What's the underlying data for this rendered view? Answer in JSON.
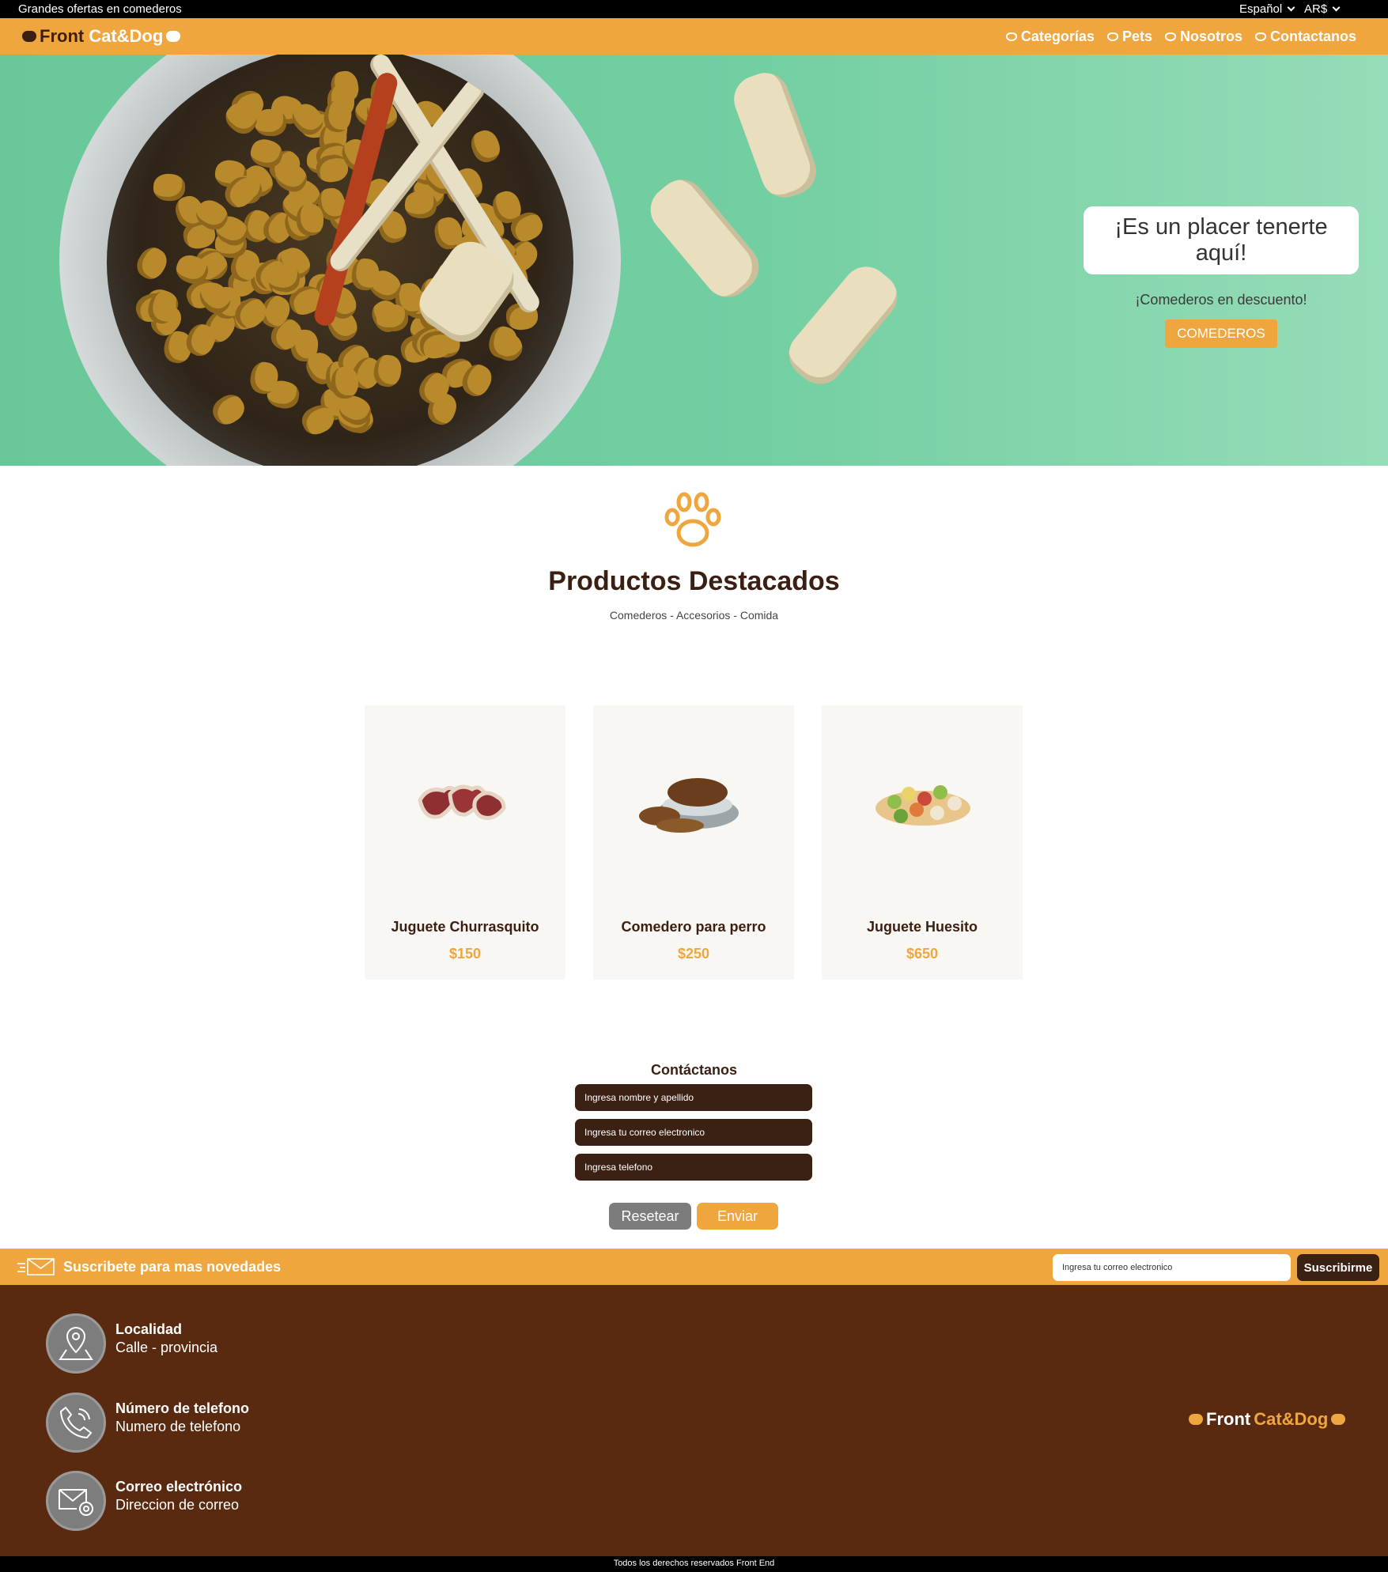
{
  "topbar": {
    "promo": "Grandes ofertas en comederos",
    "language": "Español",
    "currency": "AR$"
  },
  "brand": {
    "part1": "Front",
    "part2": "Cat&Dog"
  },
  "nav": {
    "items": [
      {
        "label": "Categorías",
        "icon": "paw-icon"
      },
      {
        "label": "Pets",
        "icon": "paw-icon"
      },
      {
        "label": "Nosotros",
        "icon": "paw-icon"
      },
      {
        "label": "Contactanos",
        "icon": "paw-icon"
      }
    ]
  },
  "hero": {
    "headline": "¡Es un placer tenerte aquí!",
    "subtitle": "¡Comederos en descuento!",
    "cta": "COMEDEROS"
  },
  "featured": {
    "title": "Productos Destacados",
    "subtitle": "Comederos - Accesorios - Comida",
    "products": [
      {
        "name": "Juguete Churrasquito",
        "price": "$150"
      },
      {
        "name": "Comedero para perro",
        "price": "$250"
      },
      {
        "name": "Juguete Huesito",
        "price": "$650"
      }
    ]
  },
  "contact": {
    "title": "Contáctanos",
    "name_placeholder": "Ingresa nombre y apellido",
    "email_placeholder": "Ingresa tu correo electronico",
    "phone_placeholder": "Ingresa telefono",
    "reset_label": "Resetear",
    "send_label": "Enviar"
  },
  "subscribe": {
    "text": "Suscribete para mas novedades",
    "placeholder": "Ingresa tu correo electronico",
    "button": "Suscribirme"
  },
  "footer": {
    "items": [
      {
        "title": "Localidad",
        "value": "Calle - provincia",
        "icon": "location-icon"
      },
      {
        "title": "Número de telefono",
        "value": "Numero de telefono",
        "icon": "phone-icon"
      },
      {
        "title": "Correo electrónico",
        "value": "Direccion de correo",
        "icon": "email-icon"
      }
    ],
    "copyright": "Todos los derechos reservados Front End"
  },
  "colors": {
    "accent": "#f0a63f",
    "dark_brown": "#3b2014",
    "footer_brown": "#5a2a10",
    "hero_green": "#73cfa2"
  }
}
